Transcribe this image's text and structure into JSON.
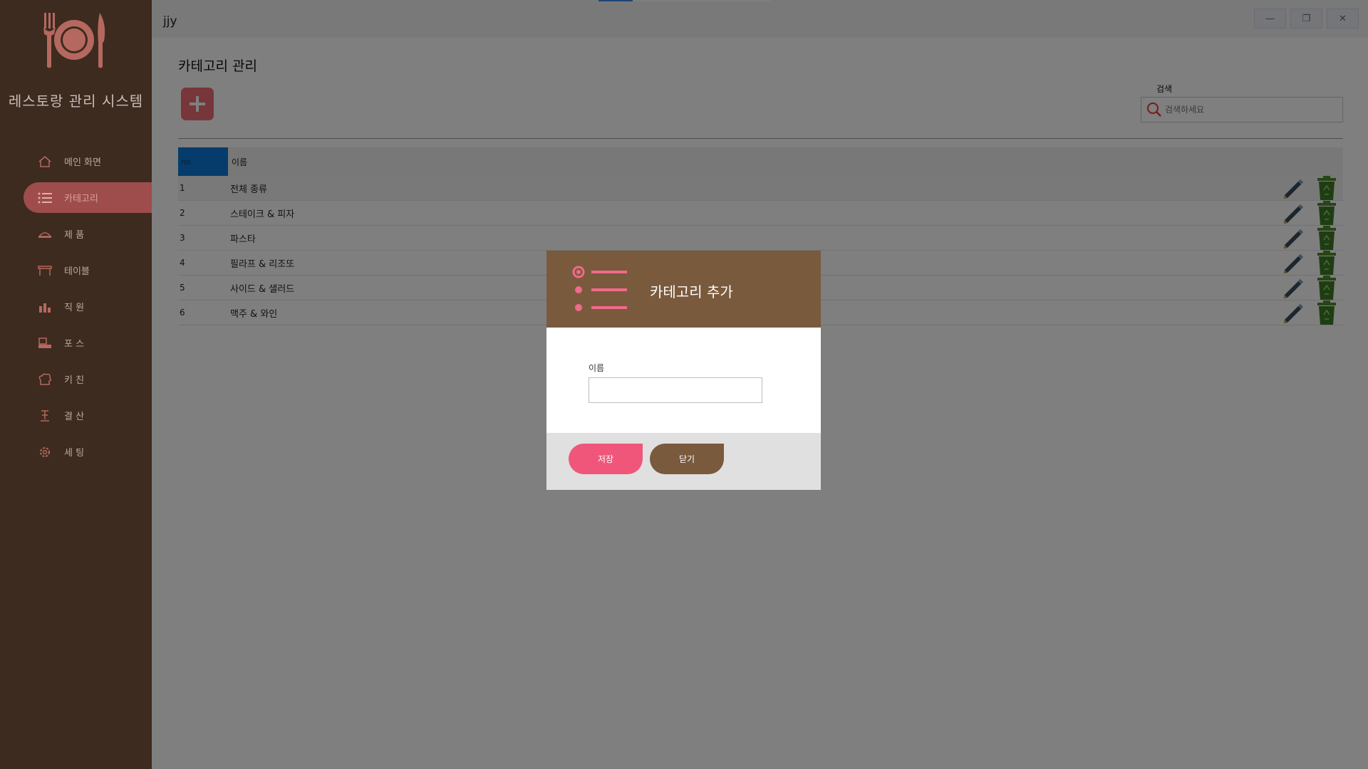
{
  "app": {
    "title": "레스토랑 관리 시스템",
    "window_title": "jjy"
  },
  "sidebar": {
    "items": [
      {
        "label": "메인 화면",
        "icon": "home-icon"
      },
      {
        "label": "카테고리",
        "icon": "list-icon",
        "active": true
      },
      {
        "label": "제 품",
        "icon": "product-icon"
      },
      {
        "label": "테이블",
        "icon": "table-icon"
      },
      {
        "label": "직 원",
        "icon": "staff-icon"
      },
      {
        "label": "포 스",
        "icon": "pos-icon"
      },
      {
        "label": "키 친",
        "icon": "chef-hat-icon"
      },
      {
        "label": "결 산",
        "icon": "settlement-icon"
      },
      {
        "label": "세 팅",
        "icon": "settings-icon"
      }
    ]
  },
  "page": {
    "title": "카테고리 관리",
    "search_label": "검색",
    "search_placeholder": "검색하세요"
  },
  "table": {
    "columns": [
      "no",
      "이름"
    ],
    "rows": [
      {
        "no": "1",
        "name": "전체 종류"
      },
      {
        "no": "2",
        "name": "스테이크 & 피자"
      },
      {
        "no": "3",
        "name": "파스타"
      },
      {
        "no": "4",
        "name": "필라프 & 리조또"
      },
      {
        "no": "5",
        "name": "사이드 & 샐러드"
      },
      {
        "no": "6",
        "name": "맥주 & 와인"
      }
    ]
  },
  "modal": {
    "title": "카테고리 추가",
    "field_label": "이름",
    "field_value": "",
    "save_label": "저장",
    "close_label": "닫기"
  },
  "colors": {
    "sidebar_bg": "#3d2b1f",
    "accent_pink": "#f0567a",
    "accent_brown": "#7a5a3c",
    "header_blue": "#0a78d7"
  }
}
